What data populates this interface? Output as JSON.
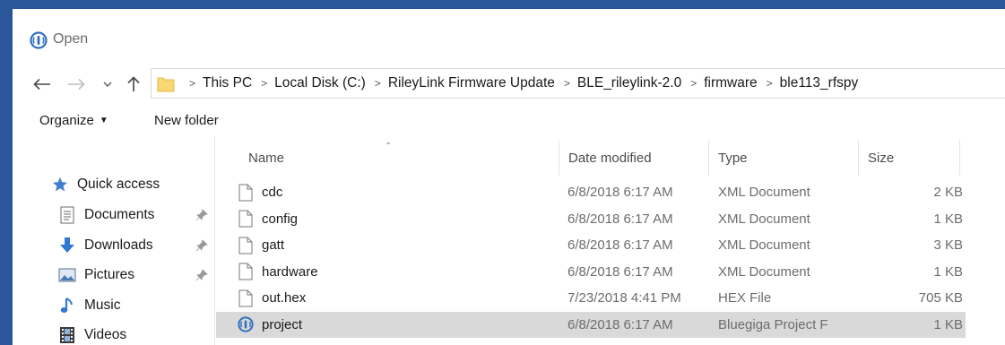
{
  "window": {
    "title": "Open"
  },
  "address": {
    "crumbs": [
      "This PC",
      "Local Disk (C:)",
      "RileyLink Firmware Update",
      "BLE_rileylink-2.0",
      "firmware",
      "ble113_rfspy"
    ]
  },
  "toolbar": {
    "organize_label": "Organize",
    "new_folder_label": "New folder"
  },
  "nav": {
    "quick_access": "Quick access",
    "items": [
      {
        "label": "Documents",
        "icon": "documents-icon",
        "pinned": true
      },
      {
        "label": "Downloads",
        "icon": "downloads-icon",
        "pinned": true
      },
      {
        "label": "Pictures",
        "icon": "pictures-icon",
        "pinned": true
      },
      {
        "label": "Music",
        "icon": "music-icon",
        "pinned": false
      },
      {
        "label": "Videos",
        "icon": "videos-icon",
        "pinned": false
      }
    ]
  },
  "columns": {
    "name": "Name",
    "date": "Date modified",
    "type": "Type",
    "size": "Size"
  },
  "files": [
    {
      "name": "cdc",
      "date": "6/8/2018 6:17 AM",
      "type": "XML Document",
      "size": "2 KB",
      "icon": "file-icon",
      "selected": false
    },
    {
      "name": "config",
      "date": "6/8/2018 6:17 AM",
      "type": "XML Document",
      "size": "1 KB",
      "icon": "file-icon",
      "selected": false
    },
    {
      "name": "gatt",
      "date": "6/8/2018 6:17 AM",
      "type": "XML Document",
      "size": "3 KB",
      "icon": "file-icon",
      "selected": false
    },
    {
      "name": "hardware",
      "date": "6/8/2018 6:17 AM",
      "type": "XML Document",
      "size": "1 KB",
      "icon": "file-icon",
      "selected": false
    },
    {
      "name": "out.hex",
      "date": "7/23/2018 4:41 PM",
      "type": "HEX File",
      "size": "705 KB",
      "icon": "file-icon",
      "selected": false
    },
    {
      "name": "project",
      "date": "6/8/2018 6:17 AM",
      "type": "Bluegiga Project F",
      "size": "1 KB",
      "icon": "bluegiga-icon",
      "selected": true
    }
  ],
  "colors": {
    "accent": "#2b579a",
    "selection": "#d9d9d9",
    "folder": "#f8d775",
    "star": "#3f7fd0"
  }
}
